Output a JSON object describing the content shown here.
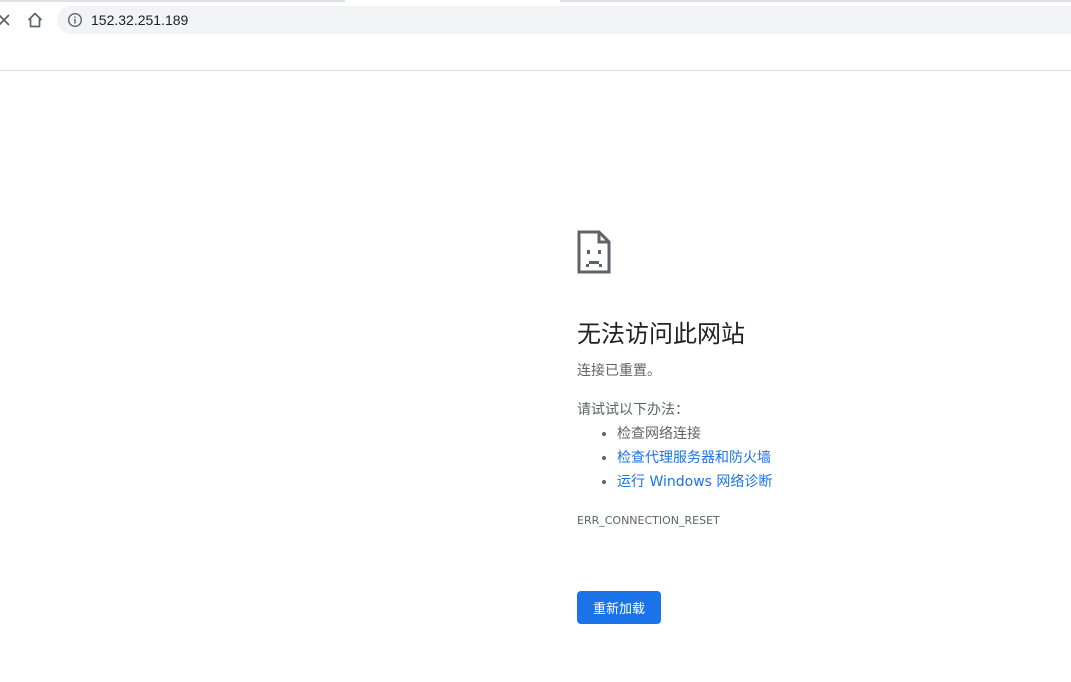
{
  "browser": {
    "url": "152.32.251.189",
    "icons": {
      "close": "close-icon",
      "home": "home-icon",
      "site_info": "info-icon"
    }
  },
  "error_page": {
    "icon": "sad-page-icon",
    "heading": "无法访问此网站",
    "summary": "连接已重置。",
    "suggestions_title": "请试试以下办法：",
    "suggestions": [
      {
        "label": "检查网络连接",
        "link": false
      },
      {
        "label": "检查代理服务器和防火墙",
        "link": true
      },
      {
        "label": "运行 Windows 网络诊断",
        "link": true
      }
    ],
    "error_code": "ERR_CONNECTION_RESET",
    "reload_label": "重新加载"
  },
  "colors": {
    "link": "#1a73e8",
    "button": "#1a73e8",
    "text": "#5f6368",
    "heading": "#202124",
    "omnibox": "#f1f3f4"
  }
}
